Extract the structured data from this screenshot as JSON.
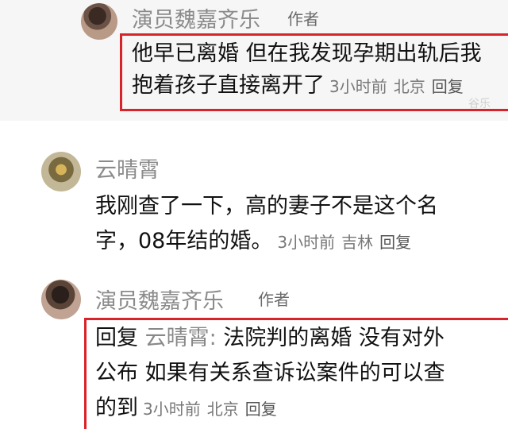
{
  "comments": [
    {
      "name": "演员魏嘉齐乐",
      "tag": "作者",
      "line1": "他早已离婚 但在我发现孕期出轨后我",
      "line2": "抱着孩子直接离开了",
      "time": "3小时前",
      "location": "北京",
      "reply": "回复"
    },
    {
      "name": "云晴霄",
      "line1": "我刚查了一下，高的妻子不是这个名",
      "line2": "字，08年结的婚。",
      "time": "3小时前",
      "location": "吉林",
      "reply": "回复"
    },
    {
      "name": "演员魏嘉齐乐",
      "tag": "作者",
      "reply_prefix": "回复",
      "reply_to": "云晴霄:",
      "line1_rest": "法院判的离婚 没有对外",
      "line2": "公布 如果有关系查诉讼案件的可以查",
      "line3": "的到",
      "time": "3小时前",
      "location": "北京",
      "reply": "回复"
    }
  ],
  "watermark": "谷乐"
}
